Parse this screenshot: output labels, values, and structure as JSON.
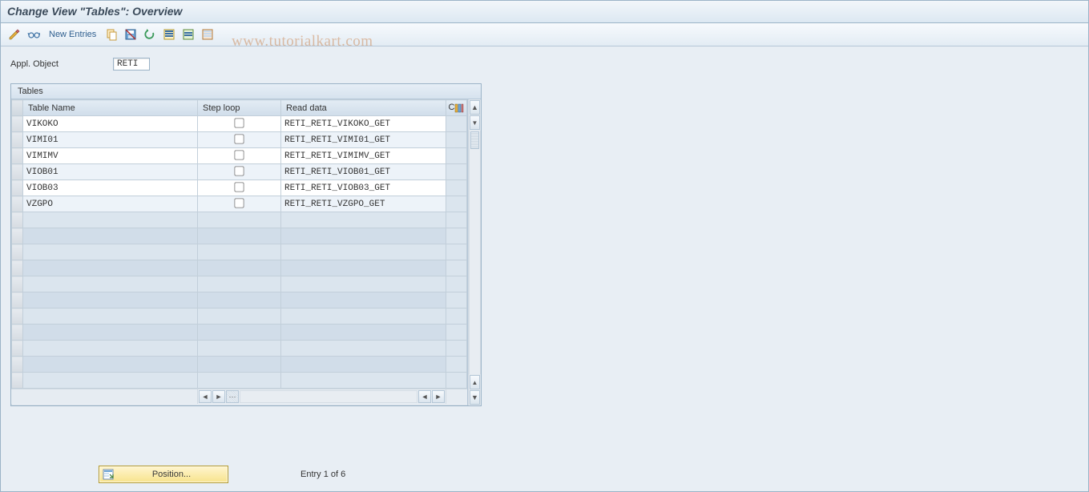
{
  "title": "Change View \"Tables\": Overview",
  "toolbar": {
    "new_entries_label": "New Entries"
  },
  "watermark": "www.tutorialkart.com",
  "form": {
    "appl_object_label": "Appl. Object",
    "appl_object_value": "RETI"
  },
  "panel": {
    "title": "Tables",
    "columns": {
      "name": "Table Name",
      "step": "Step loop",
      "read": "Read data",
      "last": "C"
    },
    "rows": [
      {
        "name": "VIKOKO",
        "step": false,
        "read": "RETI_RETI_VIKOKO_GET"
      },
      {
        "name": "VIMI01",
        "step": false,
        "read": "RETI_RETI_VIMI01_GET"
      },
      {
        "name": "VIMIMV",
        "step": false,
        "read": "RETI_RETI_VIMIMV_GET"
      },
      {
        "name": "VIOB01",
        "step": false,
        "read": "RETI_RETI_VIOB01_GET"
      },
      {
        "name": "VIOB03",
        "step": false,
        "read": "RETI_RETI_VIOB03_GET"
      },
      {
        "name": "VZGPO",
        "step": false,
        "read": "RETI_RETI_VZGPO_GET"
      }
    ],
    "blank_row_count": 11
  },
  "footer": {
    "position_button_label": "Position...",
    "status": "Entry 1 of 6"
  },
  "icons": {
    "toggle": "toggle-icon",
    "glasses": "glasses-icon",
    "copy": "copy-icon",
    "save_var": "save-variant-icon",
    "undo": "undo-icon",
    "select_all": "select-all-icon",
    "select_block": "select-block-icon",
    "deselect": "deselect-icon",
    "config": "config-columns-icon"
  }
}
